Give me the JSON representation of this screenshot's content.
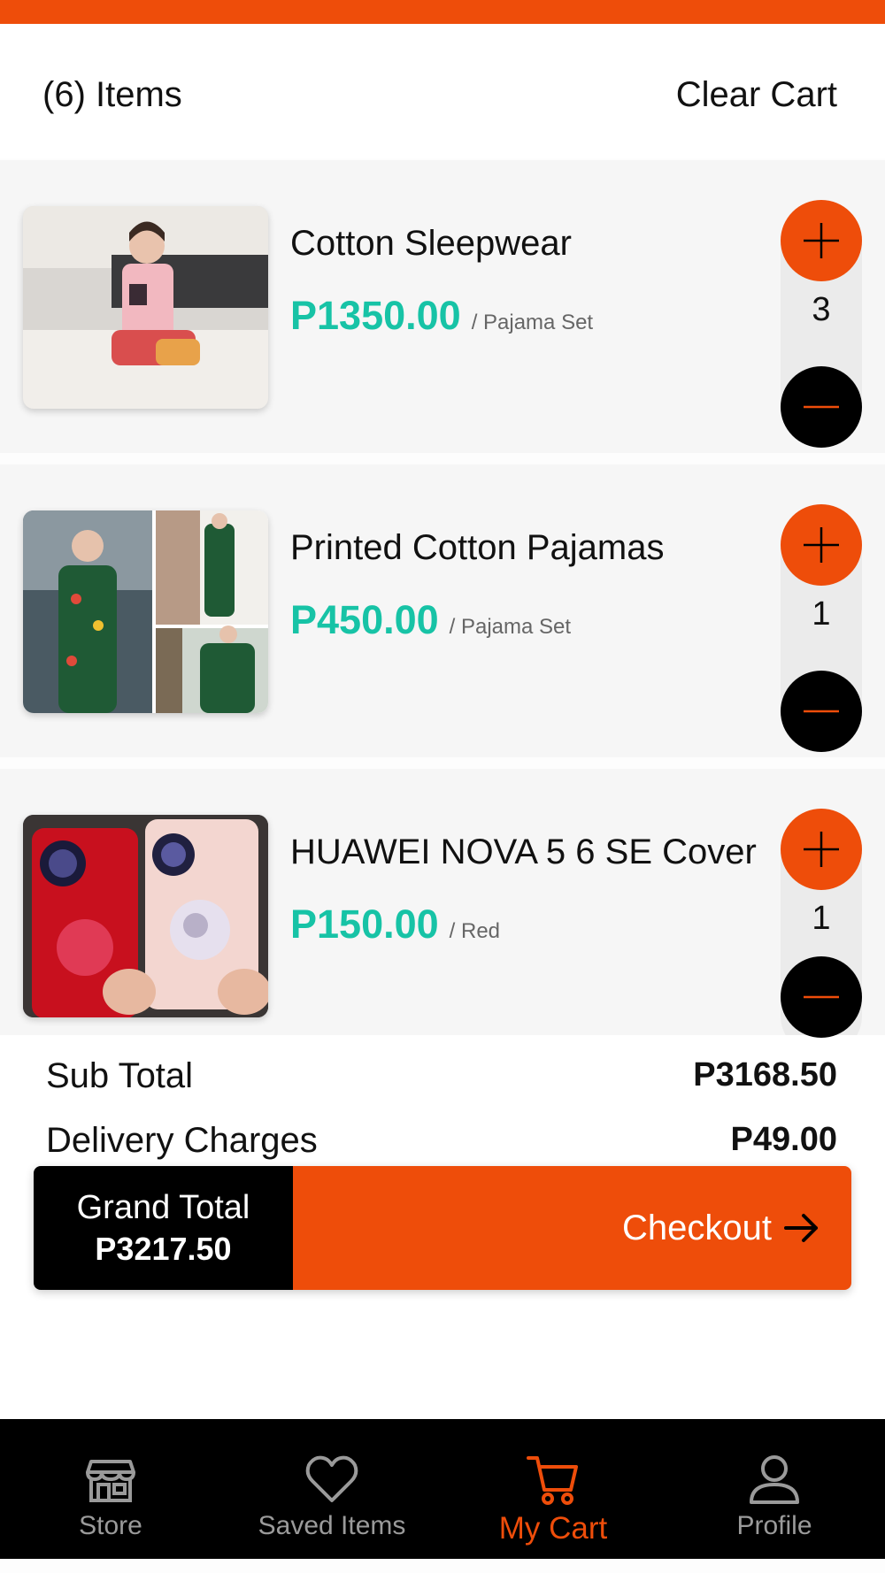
{
  "colors": {
    "accent": "#ee4d0a",
    "price": "#17c3a6",
    "dark": "#000000",
    "muted": "#9a9a9a"
  },
  "header": {
    "items_count": "(6) Items",
    "clear_cart": "Clear Cart"
  },
  "cart_items": [
    {
      "name": "Cotton Sleepwear",
      "price": "P1350.00",
      "variant": "/ Pajama Set",
      "quantity": "3",
      "image": "pink-pajama-photo"
    },
    {
      "name": "Printed Cotton Pajamas",
      "price": "P450.00",
      "variant": "/ Pajama Set",
      "quantity": "1",
      "image": "green-pajama-collage"
    },
    {
      "name": "HUAWEI NOVA 5 6 SE Cover",
      "price": "P150.00",
      "variant": "/ Red",
      "quantity": "1",
      "image": "phone-cases-photo"
    }
  ],
  "summary": {
    "subtotal_label": "Sub Total",
    "subtotal_value": "P3168.50",
    "delivery_label": "Delivery Charges",
    "delivery_value": "P49.00",
    "grand_total_label": "Grand Total",
    "grand_total_value": "P3217.50",
    "checkout_label": "Checkout",
    "checkout_icon": "arrow-right-icon"
  },
  "nav": [
    {
      "label": "Store",
      "icon": "store-icon",
      "active": false
    },
    {
      "label": "Saved Items",
      "icon": "heart-icon",
      "active": false
    },
    {
      "label": "My Cart",
      "icon": "cart-icon",
      "active": true
    },
    {
      "label": "Profile",
      "icon": "user-icon",
      "active": false
    }
  ]
}
